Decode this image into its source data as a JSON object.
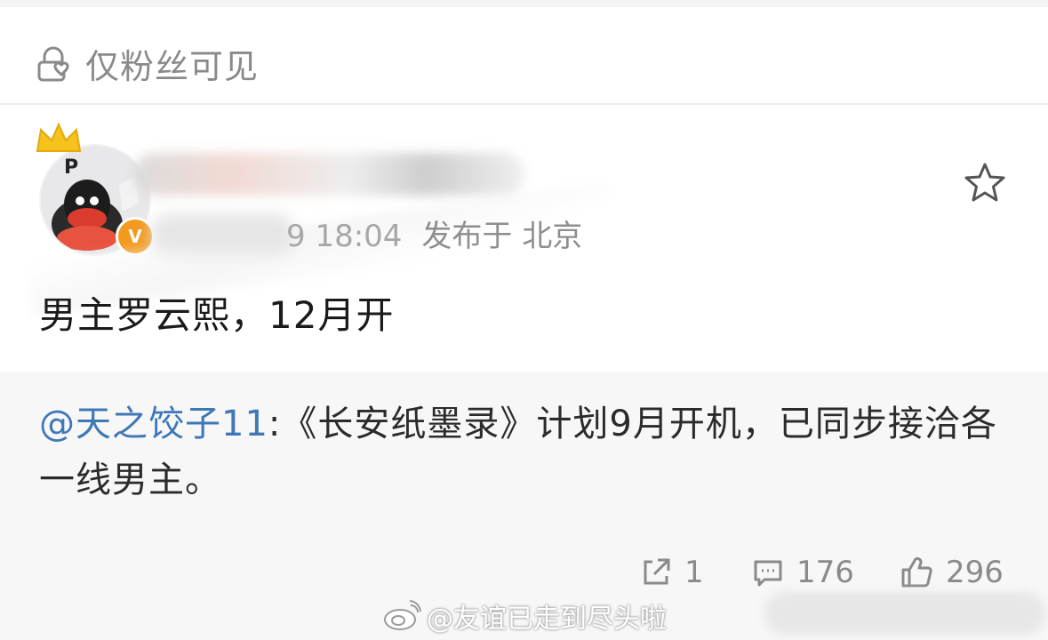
{
  "visibility": {
    "icon": "lock-heart-icon",
    "label": "仅粉丝可见"
  },
  "author": {
    "avatar_letter": "P",
    "badge": "V",
    "crown_icon": "crown-icon",
    "time": "9 18:04",
    "published_in": "发布于 北京"
  },
  "post": {
    "text": "男主罗云熙，12月开"
  },
  "repost": {
    "mention": "@天之饺子11",
    "text": ":《长安纸墨录》计划9月开机，已同步接洽各一线男主。"
  },
  "actions": {
    "share": {
      "icon": "share-icon",
      "count": "1"
    },
    "comment": {
      "icon": "comment-icon",
      "count": "176"
    },
    "like": {
      "icon": "thumbs-up-icon",
      "count": "296"
    }
  },
  "watermark": {
    "icon": "weibo-icon",
    "text": "@友谊已走到尽头啦"
  },
  "colors": {
    "mention": "#3f78b6",
    "badge": "#f39a1e",
    "muted": "#8a8a8a",
    "repost_bg": "#f7f7f7"
  }
}
